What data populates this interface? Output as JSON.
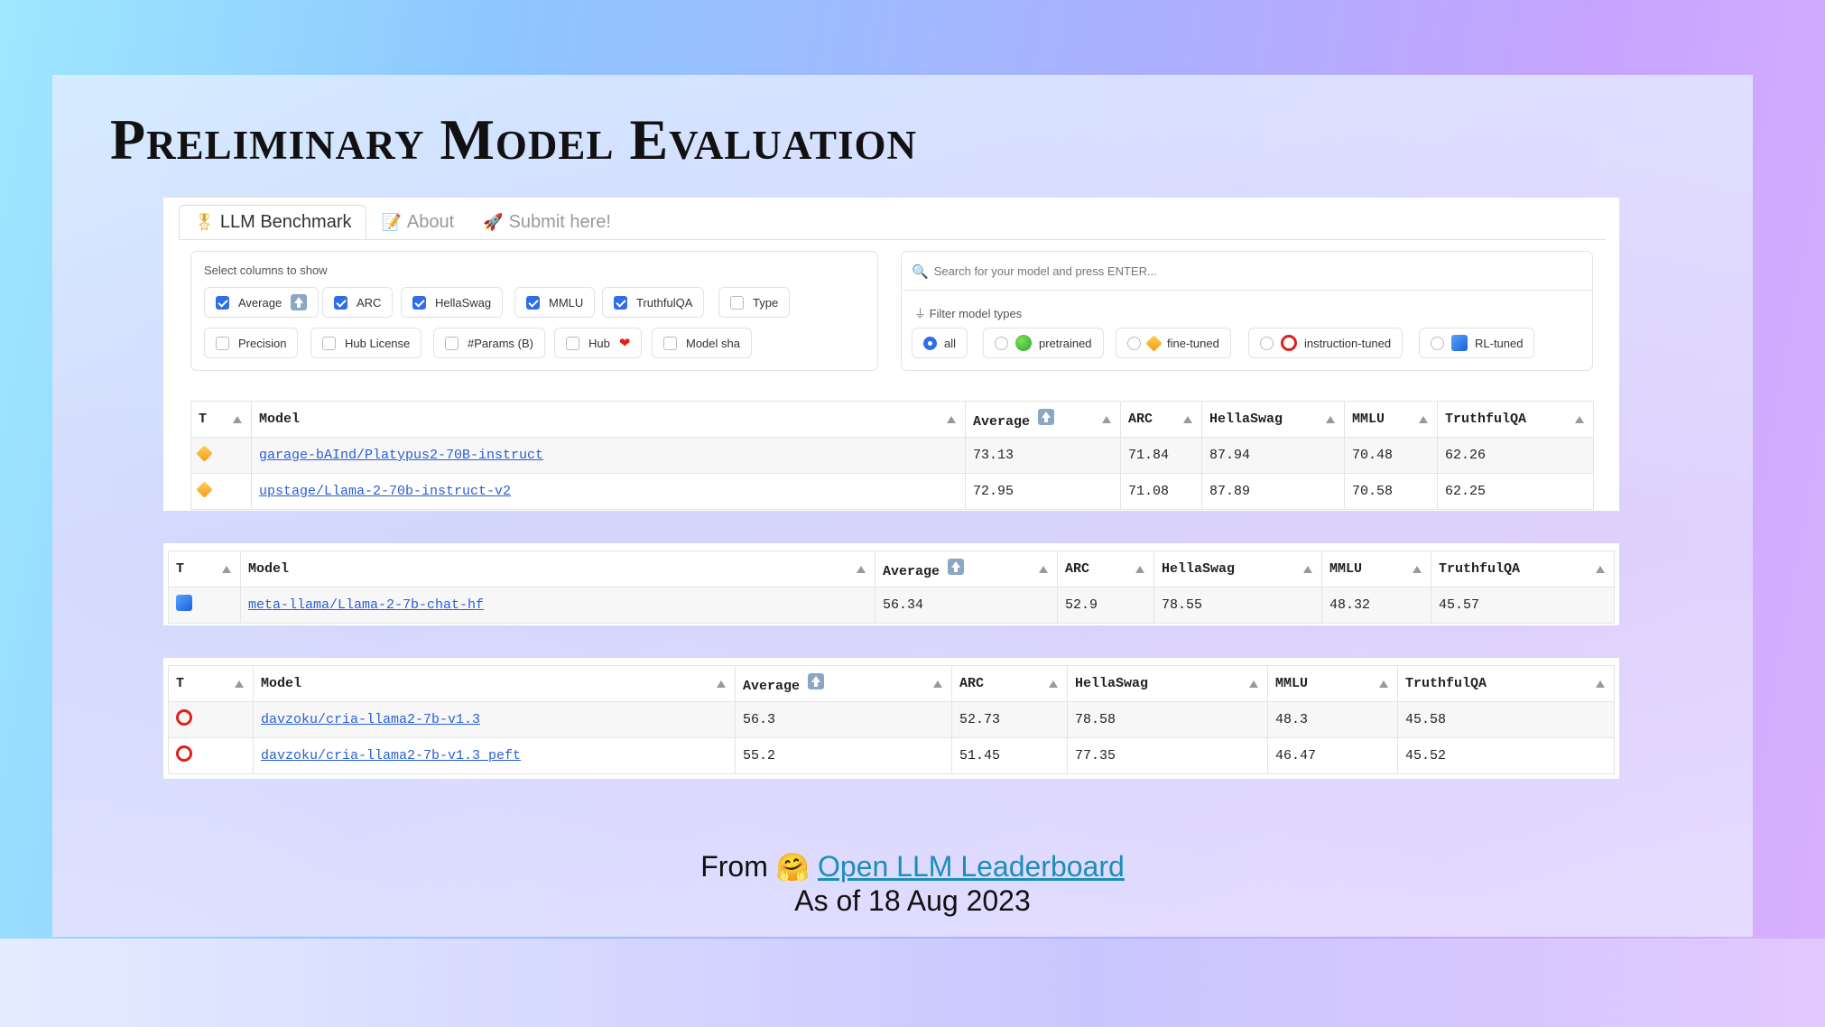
{
  "slide": {
    "title": "Preliminary Model Evaluation",
    "footer_from": "From",
    "footer_link": "Open LLM Leaderboard",
    "footer_date": "As of 18 Aug 2023",
    "hug_icon": "🤗"
  },
  "tabs": [
    {
      "label": "LLM Benchmark",
      "icon": "medal-icon",
      "glyph": "🎖",
      "active": true
    },
    {
      "label": "About",
      "icon": "memo-icon",
      "glyph": "📝",
      "active": false
    },
    {
      "label": "Submit here!",
      "icon": "rocket-icon",
      "glyph": "🚀",
      "active": false
    }
  ],
  "columns_panel": {
    "label": "Select columns to show",
    "options": [
      {
        "label": "Average",
        "checked": true,
        "icon": "up-arrow-icon"
      },
      {
        "label": "ARC",
        "checked": true
      },
      {
        "label": "HellaSwag",
        "checked": true
      },
      {
        "label": "MMLU",
        "checked": true
      },
      {
        "label": "TruthfulQA",
        "checked": true
      },
      {
        "label": "Type",
        "checked": false
      },
      {
        "label": "Precision",
        "checked": false
      },
      {
        "label": "Hub License",
        "checked": false
      },
      {
        "label": "#Params (B)",
        "checked": false
      },
      {
        "label": "Hub",
        "checked": false,
        "icon": "heart-icon"
      },
      {
        "label": "Model sha",
        "checked": false
      }
    ]
  },
  "search": {
    "placeholder": "Search for your model and press ENTER...",
    "filter_label": "Filter model types",
    "filters": [
      {
        "label": "all",
        "selected": true
      },
      {
        "label": "pretrained",
        "selected": false,
        "icon": "green-circle-icon"
      },
      {
        "label": "fine-tuned",
        "selected": false,
        "icon": "orange-diamond-icon"
      },
      {
        "label": "instruction-tuned",
        "selected": false,
        "icon": "red-ring-icon"
      },
      {
        "label": "RL-tuned",
        "selected": false,
        "icon": "blue-square-icon"
      }
    ]
  },
  "table_headers": [
    "T",
    "Model",
    "Average",
    "ARC",
    "HellaSwag",
    "MMLU",
    "TruthfulQA"
  ],
  "tables": [
    {
      "rows": [
        {
          "type_icon": "orange-diamond-icon",
          "model": "garage-bAInd/Platypus2-70B-instruct",
          "average": "73.13",
          "arc": "71.84",
          "hellaswag": "87.94",
          "mmlu": "70.48",
          "truthfulqa": "62.26"
        },
        {
          "type_icon": "orange-diamond-icon",
          "model": "upstage/Llama-2-70b-instruct-v2",
          "average": "72.95",
          "arc": "71.08",
          "hellaswag": "87.89",
          "mmlu": "70.58",
          "truthfulqa": "62.25"
        }
      ]
    },
    {
      "rows": [
        {
          "type_icon": "blue-square-icon",
          "model": "meta-llama/Llama-2-7b-chat-hf",
          "average": "56.34",
          "arc": "52.9",
          "hellaswag": "78.55",
          "mmlu": "48.32",
          "truthfulqa": "45.57"
        }
      ]
    },
    {
      "rows": [
        {
          "type_icon": "red-ring-icon",
          "model": "davzoku/cria-llama2-7b-v1.3",
          "average": "56.3",
          "arc": "52.73",
          "hellaswag": "78.58",
          "mmlu": "48.3",
          "truthfulqa": "45.58"
        },
        {
          "type_icon": "red-ring-icon",
          "model": "davzoku/cria-llama2-7b-v1.3_peft",
          "average": "55.2",
          "arc": "51.45",
          "hellaswag": "77.35",
          "mmlu": "46.47",
          "truthfulqa": "45.52"
        }
      ]
    }
  ]
}
